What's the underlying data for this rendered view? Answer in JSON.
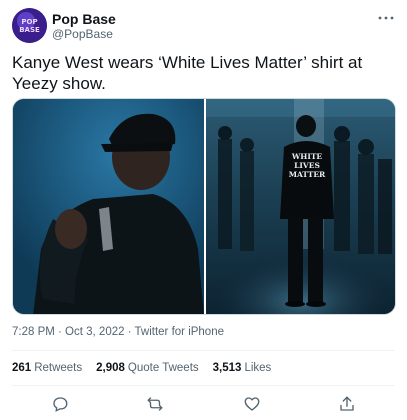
{
  "author": {
    "display_name": "Pop Base",
    "handle": "@PopBase",
    "avatar_label": "POP\nBASE"
  },
  "tweet": {
    "text": "Kanye West wears ‘White Lives Matter’ shirt at Yeezy show.",
    "timestamp": "7:28 PM · Oct 3, 2022 · Twitter for iPhone"
  },
  "media": {
    "left_image": "kanye-closeup-photo",
    "right_image": "kanye-back-white-lives-matter-shirt-photo",
    "shirt_text": "WHITE\nLIVES\nMATTER"
  },
  "stats": {
    "retweets_count": "261",
    "retweets_label": "Retweets",
    "quotes_count": "2,908",
    "quotes_label": "Quote Tweets",
    "likes_count": "3,513",
    "likes_label": "Likes"
  },
  "icons": {
    "more": "more-icon",
    "reply": "reply-icon",
    "retweet": "retweet-icon",
    "like": "like-icon",
    "share": "share-icon"
  },
  "colors": {
    "text_primary": "#0f1419",
    "text_secondary": "#536471",
    "border": "#eff3f4"
  }
}
